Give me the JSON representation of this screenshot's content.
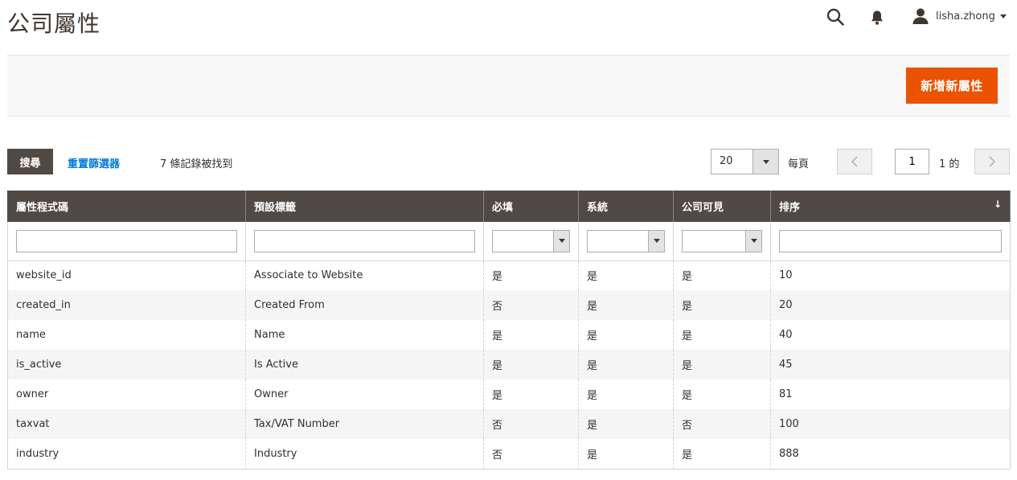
{
  "header": {
    "title": "公司屬性",
    "username": "lisha.zhong"
  },
  "action_bar": {
    "add_button": "新增新屬性"
  },
  "toolbar": {
    "search_button": "搜尋",
    "reset_link": "重置篩選器",
    "records_found": "7 條記錄被找到",
    "per_page_value": "20",
    "per_page_label": "每頁",
    "current_page": "1",
    "page_of": "1 的"
  },
  "grid": {
    "columns": [
      "屬性程式碼",
      "預設標籤",
      "必填",
      "系統",
      "公司可見",
      "排序"
    ],
    "sort_indicator": "↓",
    "rows": [
      [
        "website_id",
        "Associate to Website",
        "是",
        "是",
        "是",
        "10"
      ],
      [
        "created_in",
        "Created From",
        "否",
        "是",
        "是",
        "20"
      ],
      [
        "name",
        "Name",
        "是",
        "是",
        "是",
        "40"
      ],
      [
        "is_active",
        "Is Active",
        "是",
        "是",
        "是",
        "45"
      ],
      [
        "owner",
        "Owner",
        "是",
        "是",
        "是",
        "81"
      ],
      [
        "taxvat",
        "Tax/VAT Number",
        "否",
        "是",
        "否",
        "100"
      ],
      [
        "industry",
        "Industry",
        "否",
        "是",
        "是",
        "888"
      ]
    ]
  },
  "colors": {
    "accent": "#eb5202",
    "header_bg": "#514943",
    "link": "#007bdb"
  },
  "icons": {
    "search": "search-icon",
    "notifications": "bell-icon",
    "user": "user-icon"
  }
}
